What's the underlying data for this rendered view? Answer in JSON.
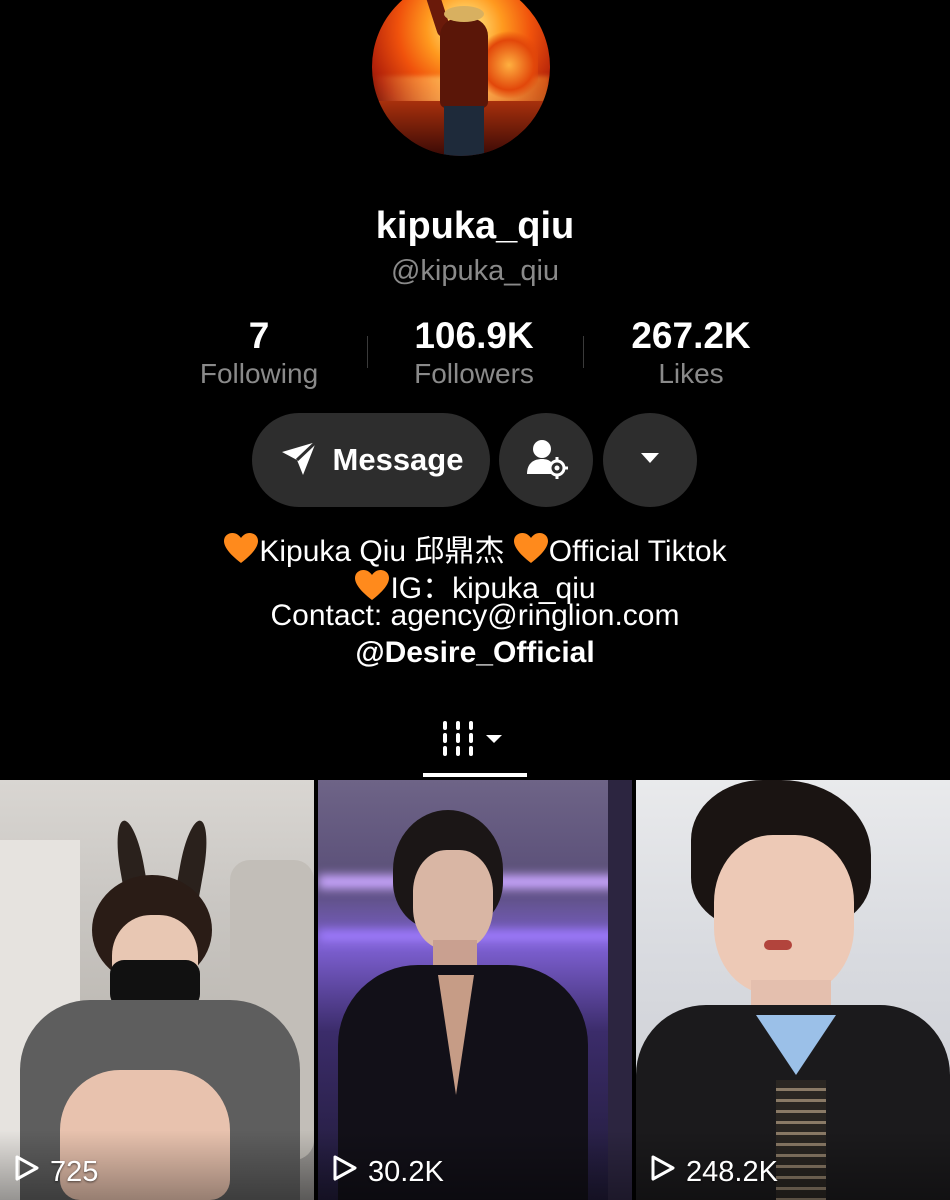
{
  "profile": {
    "username": "kipuka_qiu",
    "handle": "@kipuka_qiu",
    "avatar_icon": "profile-avatar"
  },
  "stats": [
    {
      "value": "7",
      "label": "Following"
    },
    {
      "value": "106.9K",
      "label": "Followers"
    },
    {
      "value": "267.2K",
      "label": "Likes"
    }
  ],
  "actions": {
    "message_label": "Message",
    "message_icon": "send-icon",
    "friend_icon": "user-settings-icon",
    "more_icon": "caret-down-icon"
  },
  "bio": {
    "line1_part1": "Kipuka Qiu 邱鼎杰 ",
    "line1_part2": "Official Tiktok",
    "line2": "IG：kipuka_qiu",
    "line3": "Contact: agency@ringlion.com",
    "line4": "@Desire_Official",
    "heart_color": "#ff8a1c"
  },
  "tabs": {
    "active_icon": "grid-icon"
  },
  "videos": [
    {
      "views": "725"
    },
    {
      "views": "30.2K"
    },
    {
      "views": "248.2K"
    }
  ]
}
